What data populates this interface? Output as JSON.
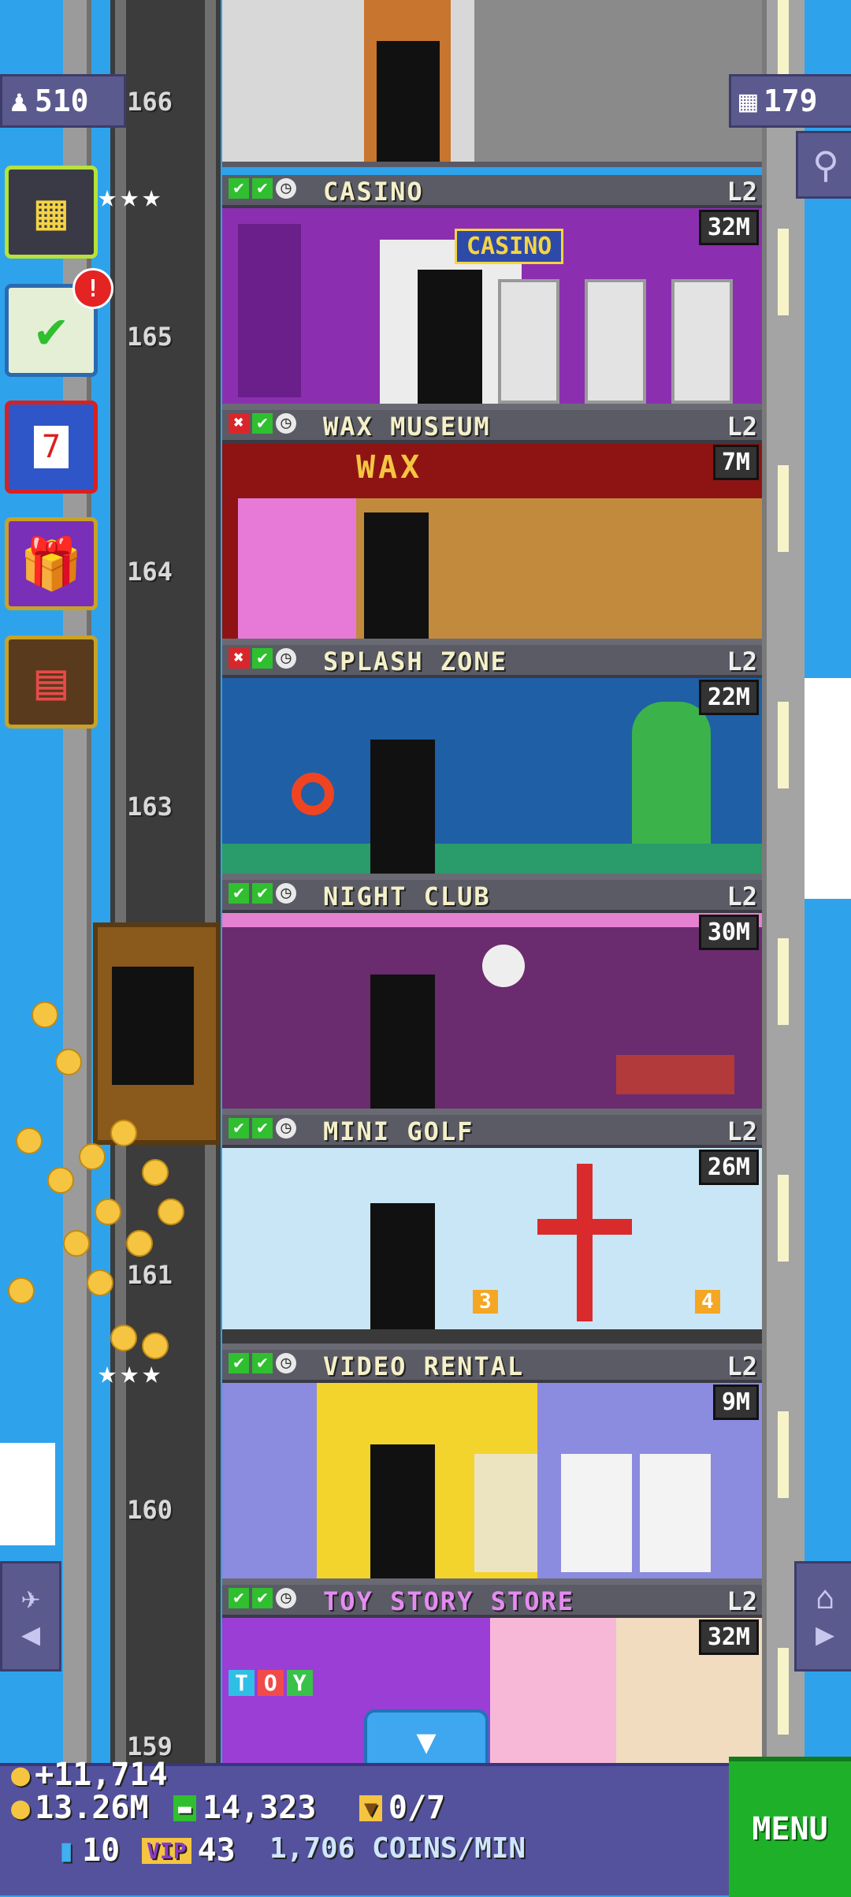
{
  "top": {
    "population": "510",
    "floors_count": "179"
  },
  "floor_numbers": [
    "166",
    "165",
    "164",
    "163",
    "161",
    "160",
    "159"
  ],
  "floors": [
    {
      "name": "CASINO",
      "level": "L2",
      "price": "32M",
      "sign": "CASINO",
      "status": [
        "check",
        "check",
        "clock"
      ]
    },
    {
      "name": "WAX MUSEUM",
      "level": "L2",
      "price": "7M",
      "sign": "WAX",
      "status": [
        "x",
        "check",
        "clock"
      ]
    },
    {
      "name": "SPLASH ZONE",
      "level": "L2",
      "price": "22M",
      "status": [
        "x",
        "check",
        "clock"
      ]
    },
    {
      "name": "NIGHT CLUB",
      "level": "L2",
      "price": "30M",
      "status": [
        "check",
        "check",
        "clock"
      ]
    },
    {
      "name": "MINI GOLF",
      "level": "L2",
      "price": "26M",
      "hole_a": "3",
      "hole_b": "4",
      "status": [
        "check",
        "check",
        "clock"
      ]
    },
    {
      "name": "VIDEO RENTAL",
      "level": "L2",
      "price": "9M",
      "status": [
        "check",
        "check",
        "clock"
      ]
    },
    {
      "name": "TOY STORY STORE",
      "level": "L2",
      "price": "32M",
      "sign": [
        "T",
        "O",
        "Y"
      ],
      "status": [
        "check",
        "check",
        "clock"
      ]
    }
  ],
  "sidebar": {
    "notification_badge": "!",
    "calendar_day": "7",
    "icons": [
      "building-icon",
      "checklist-icon",
      "calendar-icon",
      "gift-icon",
      "market-icon"
    ]
  },
  "hud": {
    "coin_gain": "+11,714",
    "coins": "13.26M",
    "bux": "14,323",
    "vip_tickets": "0/7",
    "keys": "10",
    "golden_tickets": "43",
    "rate": "1,706 COINS/MIN",
    "menu_label": "MENU"
  },
  "colors": {
    "sky": "#2ea3ec",
    "hud": "#54529c",
    "menu": "#1fb02a",
    "floor_name": "#f4f0c8",
    "toy_name": "#e58bf2"
  }
}
